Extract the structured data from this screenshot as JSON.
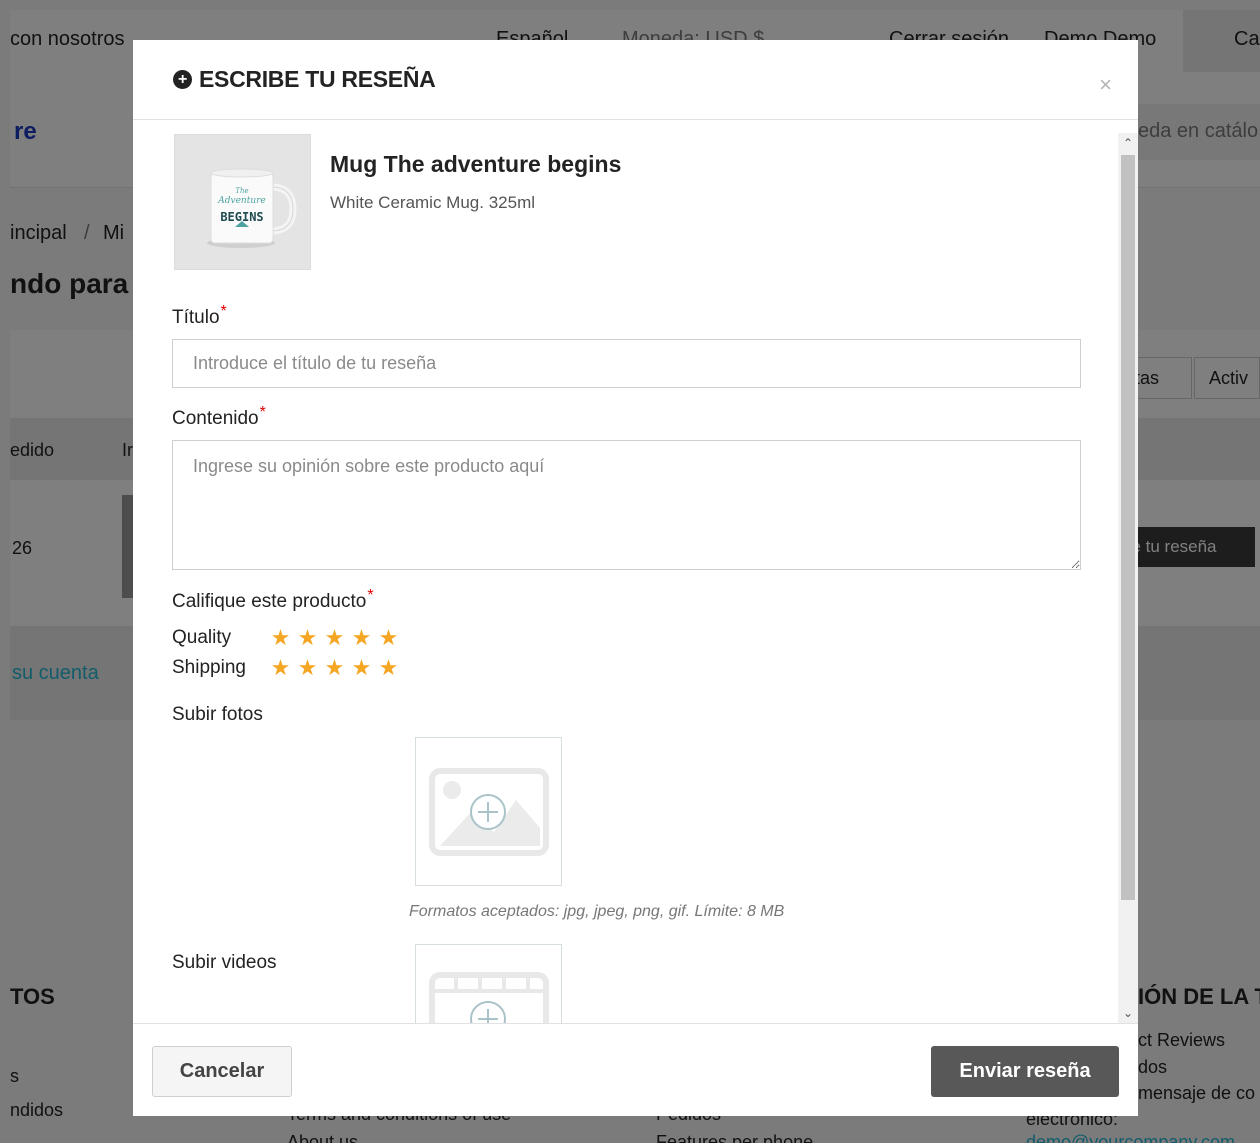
{
  "background": {
    "topbar_contact": "con nosotros",
    "topbar_language": "Español",
    "topbar_currency": "Moneda: USD $",
    "topbar_logout": "Cerrar sesión",
    "topbar_user": "Demo Demo",
    "topbar_cart": "Ca",
    "logo": "re",
    "search_placeholder": "eda en catálo",
    "breadcrumb_home": "incipal",
    "breadcrumb_sep": "/",
    "breadcrumb_current": "Mi",
    "page_heading": "ndo para",
    "tab_1": "ntas",
    "tab_2": "Activ",
    "col_order": "edido",
    "col_i": "Ir",
    "row_number": "26",
    "row_button": "be tu reseña",
    "link_account": "su cuenta",
    "footer_left_heading": "TOS",
    "footer_left_item1": "s",
    "footer_left_item2": "ndidos",
    "footer_mid1": "Terms and conditions of use",
    "footer_mid2": "About us",
    "footer_mid3": "Pedidos",
    "footer_mid4": "Features per phone",
    "footer_right_heading": "IÓN DE LA T",
    "footer_right_item1": "ct Reviews",
    "footer_right_item2": "dos",
    "footer_right_item3": "mensaje de co",
    "footer_right_item4": "electrónico:",
    "footer_right_item5": "demo@yourcompany.com"
  },
  "modal": {
    "title": "ESCRIBE TU RESEÑA",
    "close_symbol": "×",
    "product": {
      "name": "Mug The adventure begins",
      "description": "White Ceramic Mug. 325ml",
      "image_caption_top": "The",
      "image_caption_mid": "Adventure",
      "image_caption_bottom": "BEGINS"
    },
    "title_field": {
      "label": "Título",
      "required_mark": "*",
      "placeholder": "Introduce el título de tu reseña",
      "value": ""
    },
    "content_field": {
      "label": "Contenido",
      "required_mark": "*",
      "placeholder": "Ingrese su opinión sobre este producto aquí",
      "value": ""
    },
    "rating": {
      "label": "Califique este producto",
      "required_mark": "*",
      "criteria": [
        {
          "name": "Quality",
          "stars": 5
        },
        {
          "name": "Shipping",
          "stars": 5
        }
      ]
    },
    "photos": {
      "label": "Subir fotos",
      "hint": "Formatos aceptados: jpg, jpeg, png, gif. Límite: 8 MB"
    },
    "videos": {
      "label": "Subir videos"
    },
    "footer": {
      "cancel_label": "Cancelar",
      "submit_label": "Enviar reseña"
    }
  },
  "colors": {
    "star": "#f5a623",
    "required": "#e20000",
    "submit_bg": "#585858",
    "link": "#24b9d7"
  }
}
